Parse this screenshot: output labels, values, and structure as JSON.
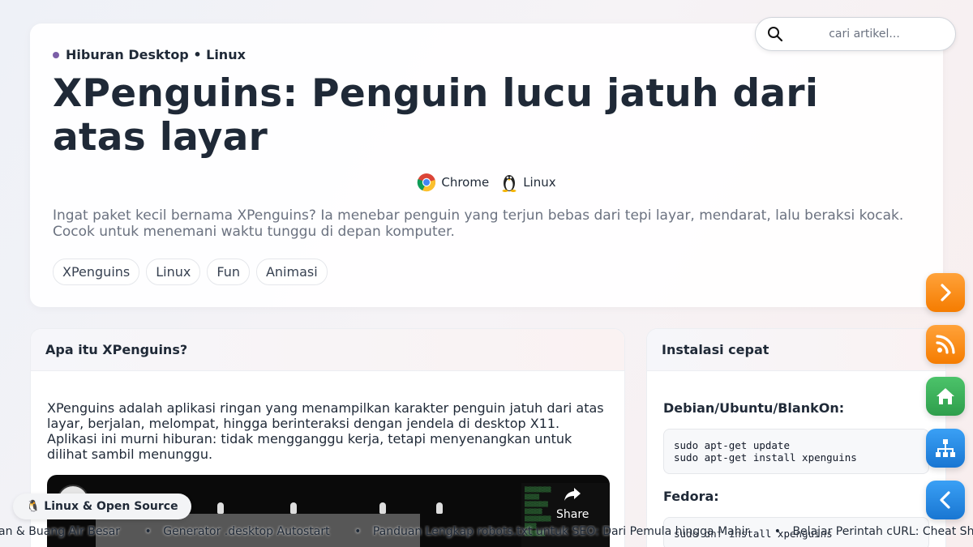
{
  "hero": {
    "breadcrumb": "Hiburan Desktop • Linux",
    "title": "XPenguins: Penguin lucu jatuh dari atas layar",
    "platforms": [
      {
        "name": "Chrome",
        "icon": "chrome-icon"
      },
      {
        "name": "Linux",
        "icon": "tux-icon"
      }
    ],
    "lead": "Ingat paket kecil bernama XPenguins? Ia menebar penguin yang terjun bebas dari tepi layar, mendarat, lalu beraksi kocak. Cocok untuk menemani waktu tunggu di depan komputer.",
    "tags": [
      "XPenguins",
      "Linux",
      "Fun",
      "Animasi"
    ]
  },
  "search": {
    "placeholder": "cari artikel...",
    "icon": "search-icon"
  },
  "main_card": {
    "heading": "Apa itu XPenguins?",
    "body": "XPenguins adalah aplikasi ringan yang menampilkan karakter penguin jatuh dari atas layar, berjalan, melompat, hingga berinteraksi dengan jendela di desktop X11. Aplikasi ini murni hiburan: tidak mengganggu kerja, tetapi menyenangkan untuk dilihat sambil menunggu.",
    "video": {
      "share_label": "Share"
    }
  },
  "side_card": {
    "heading": "Instalasi cepat",
    "sections": [
      {
        "label": "Debian/Ubuntu/BlankOn:",
        "code": "sudo apt-get update\nsudo apt-get install xpenguins"
      },
      {
        "label": "Fedora:",
        "code": "sudo dnf install xpenguins"
      }
    ]
  },
  "floating_buttons": [
    {
      "name": "next-icon",
      "color": "#f57c00"
    },
    {
      "name": "rss-icon",
      "color": "#f57c00"
    },
    {
      "name": "home-icon",
      "color": "#2e9e4c"
    },
    {
      "name": "sitemap-icon",
      "color": "#1976d2"
    },
    {
      "name": "back-icon",
      "color": "#1976d2"
    }
  ],
  "badge": {
    "label": "🐧 Linux & Open Source"
  },
  "ticker": {
    "items": [
      "an & Buang Air Besar",
      "Generator .desktop Autostart",
      "Panduan Lengkap robots.txt untuk SEO: Dari Pemula hingga Mahir",
      "Belajar Perintah cURL: Cheat Sheet Le"
    ]
  }
}
